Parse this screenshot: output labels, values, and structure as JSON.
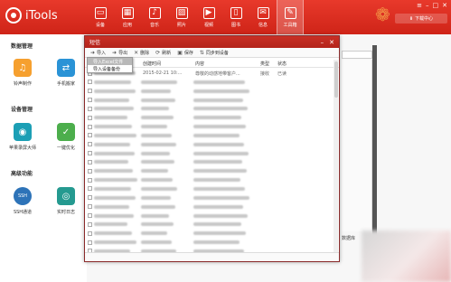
{
  "app": {
    "name": "iTools"
  },
  "nav": [
    {
      "label": "设备",
      "icon": "device-icon",
      "glyph": "▭"
    },
    {
      "label": "应用",
      "icon": "apps-icon",
      "glyph": "▦"
    },
    {
      "label": "音乐",
      "icon": "music-icon",
      "glyph": "♪"
    },
    {
      "label": "照片",
      "icon": "photo-icon",
      "glyph": "▨"
    },
    {
      "label": "视频",
      "icon": "video-icon",
      "glyph": "▶"
    },
    {
      "label": "图书",
      "icon": "book-icon",
      "glyph": "▯"
    },
    {
      "label": "信息",
      "icon": "info-icon",
      "glyph": "✉"
    },
    {
      "label": "工具箱",
      "icon": "toolbox-icon",
      "glyph": "✎"
    }
  ],
  "window_controls": {
    "min": "–",
    "max": "□",
    "close": "✕",
    "menu": "≡"
  },
  "download_center": "下载中心",
  "sidebar": {
    "sections": [
      {
        "title": "数据管理",
        "tools": [
          {
            "label": "铃声制作",
            "icon": "bell-icon",
            "glyph": "♫"
          },
          {
            "label": "手机搬家",
            "icon": "phone-transfer-icon",
            "glyph": "⇄"
          }
        ]
      },
      {
        "title": "设备管理",
        "tools": [
          {
            "label": "苹果录屏大师",
            "icon": "screen-record-icon",
            "glyph": "◉"
          },
          {
            "label": "一键优化",
            "icon": "optimize-icon",
            "glyph": "✓"
          }
        ]
      },
      {
        "title": "高级功能",
        "tools": [
          {
            "label": "SSH通道",
            "icon": "ssh-icon",
            "glyph": "SSH"
          },
          {
            "label": "实时日志",
            "icon": "log-icon",
            "glyph": "◎"
          }
        ]
      }
    ]
  },
  "dialog": {
    "title": "短信",
    "toolbar": [
      {
        "label": "导入",
        "icon": "import-icon",
        "glyph": "➜"
      },
      {
        "label": "导出",
        "icon": "export-icon",
        "glyph": "➜"
      },
      {
        "label": "删除",
        "icon": "delete-icon",
        "glyph": "✕"
      },
      {
        "label": "刷新",
        "icon": "refresh-icon",
        "glyph": "⟳"
      },
      {
        "label": "保存",
        "icon": "save-icon",
        "glyph": "▣"
      },
      {
        "label": "同步到设备",
        "icon": "sync-icon",
        "glyph": "⇅"
      }
    ],
    "dropdown": [
      "导入Excel文件",
      "导入设备备份"
    ],
    "columns": [
      "创建时间",
      "内容",
      "类型",
      "状态"
    ],
    "first_row": {
      "time": "2015-02-21 10:...",
      "content": "尊敬的动感地带客户...",
      "type": "接收",
      "status": "已读"
    },
    "row_count": 21
  },
  "background": {
    "footer_text": "数据库"
  }
}
